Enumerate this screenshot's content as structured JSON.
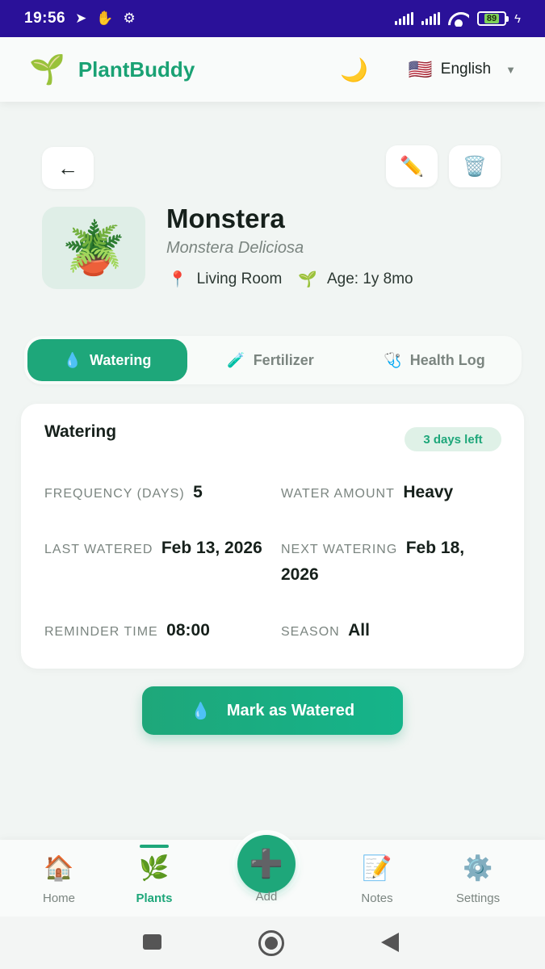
{
  "status_bar": {
    "time": "19:56",
    "left_icons": [
      "telegram-icon",
      "hand-icon",
      "gear-icon"
    ],
    "battery": "89"
  },
  "header": {
    "logo": "🌱",
    "title": "PlantBuddy",
    "theme_icon": "🌙",
    "language_flag": "🇺🇸",
    "language": "English",
    "caret": "▼"
  },
  "toolbar": {
    "back": "←",
    "edit": "✏️",
    "delete": "🗑️"
  },
  "plant": {
    "image": "🪴",
    "name": "Monstera",
    "scientific_name": "Monstera Deliciosa",
    "location_icon": "📍",
    "location": "Living Room",
    "age_icon": "🌱",
    "age": "Age: 1y 8mo"
  },
  "tabs": [
    {
      "icon": "💧",
      "label": "Watering",
      "active": true
    },
    {
      "icon": "🧪",
      "label": "Fertilizer",
      "active": false
    },
    {
      "icon": "🩺",
      "label": "Health Log",
      "active": false
    }
  ],
  "watering_card": {
    "title": "Watering",
    "badge": "3 days left",
    "fields": [
      {
        "label": "FREQUENCY (DAYS)",
        "value": "5"
      },
      {
        "label": "WATER AMOUNT",
        "value": "Heavy"
      },
      {
        "label": "LAST WATERED",
        "value": "Feb 13, 2026"
      },
      {
        "label": "NEXT WATERING",
        "value": "Feb 18, 2026"
      },
      {
        "label": "REMINDER TIME",
        "value": "08:00"
      },
      {
        "label": "SEASON",
        "value": "All"
      }
    ]
  },
  "action": {
    "icon": "💧",
    "label": "Mark as Watered"
  },
  "bottom_nav": {
    "home": {
      "icon": "🏠",
      "label": "Home"
    },
    "plants": {
      "icon": "🌿",
      "label": "Plants"
    },
    "add": {
      "icon": "➕",
      "label": "Add"
    },
    "notes": {
      "icon": "📝",
      "label": "Notes"
    },
    "settings": {
      "icon": "⚙️",
      "label": "Settings"
    }
  },
  "colors": {
    "accent": "#1ea77a",
    "status_bar": "#2a1199",
    "background": "#f1f5f3"
  }
}
